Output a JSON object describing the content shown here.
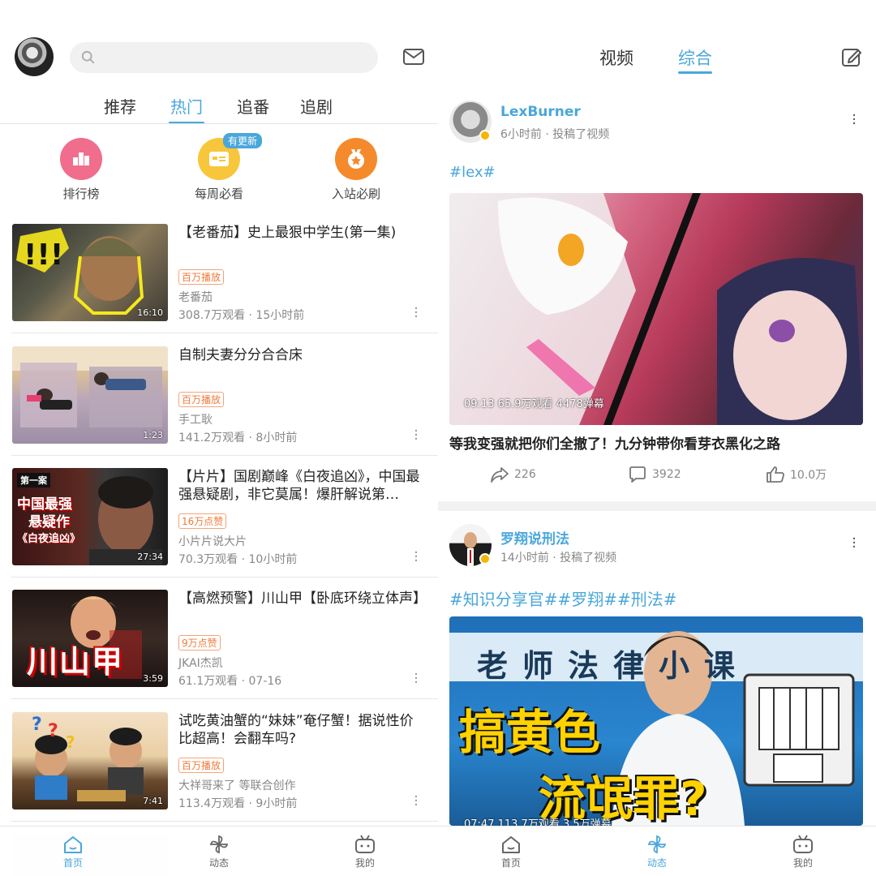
{
  "left": {
    "tabs": [
      "推荐",
      "热门",
      "追番",
      "追剧"
    ],
    "active_tab": "热门",
    "quick": [
      {
        "label": "排行榜",
        "icon": "ranking-icon",
        "color": "#f06d8e"
      },
      {
        "label": "每周必看",
        "icon": "weekly-icon",
        "color": "#f7c63b"
      },
      {
        "label": "入站必刷",
        "icon": "medal-icon",
        "color": "#f58a2c"
      }
    ],
    "badge_new": "有更新",
    "items": [
      {
        "title": "【老番茄】史上最狠中学生(第一集)",
        "tag": "百万播放",
        "up": "老番茄",
        "meta": "308.7万观看 · 15小时前",
        "duration": "16:10"
      },
      {
        "title": "自制夫妻分分合合床",
        "tag": "百万播放",
        "up": "手工耿",
        "meta": "141.2万观看 · 8小时前",
        "duration": "1:23"
      },
      {
        "title": "【片片】国剧巅峰《白夜追凶》，中国最强悬疑剧，非它莫属！爆肝解说第…",
        "tag": "16万点赞",
        "up": "小片片说大片",
        "meta": "70.3万观看 · 10小时前",
        "duration": "27:34",
        "thumb_text": [
          "第一案",
          "中国最强",
          "悬疑作",
          "《白夜追凶》"
        ]
      },
      {
        "title": "【高燃预警】川山甲【卧底环绕立体声】",
        "tag": "9万点赞",
        "up": "JKAI杰凯",
        "meta": "61.1万观看 · 07-16",
        "duration": "3:59",
        "thumb_text": [
          "川山甲"
        ]
      },
      {
        "title": "试吃黄油蟹的“妹妹”奄仔蟹！据说性价比超高！会翻车吗?",
        "tag": "百万播放",
        "up": "大祥哥来了 等联合创作",
        "meta": "113.4万观看 · 9小时前",
        "duration": "7:41"
      }
    ],
    "nav": [
      {
        "label": "首页",
        "icon": "home-icon"
      },
      {
        "label": "动态",
        "icon": "pinwheel-icon"
      },
      {
        "label": "我的",
        "icon": "tv-icon"
      }
    ],
    "nav_active": "首页"
  },
  "right": {
    "tabs": [
      "视频",
      "综合"
    ],
    "active_tab": "综合",
    "posts": [
      {
        "name": "LexBurner",
        "meta": "6小时前 · 投稿了视频",
        "hashtags": "#lex#",
        "cover_stats": "09:13   65.9万观看   4478弹幕",
        "title": "等我变强就把你们全撤了！九分钟带你看芽衣黑化之路",
        "share": "226",
        "comments": "3922",
        "likes": "10.0万"
      },
      {
        "name": "罗翔说刑法",
        "meta": "14小时前 · 投稿了视频",
        "hashtags": "#知识分享官##罗翔##刑法#",
        "cover_text": [
          "老师法律小课",
          "搞黄色",
          "流氓罪?"
        ],
        "cover_stats": "07:47   113.7万观看   3.5万弹幕"
      }
    ],
    "nav": [
      {
        "label": "首页",
        "icon": "home-icon"
      },
      {
        "label": "动态",
        "icon": "pinwheel-icon"
      },
      {
        "label": "我的",
        "icon": "tv-icon"
      }
    ],
    "nav_active": "动态"
  },
  "colors": {
    "accent": "#4aa7db",
    "tag": "#f07a3a",
    "badge": "#f7b500"
  }
}
